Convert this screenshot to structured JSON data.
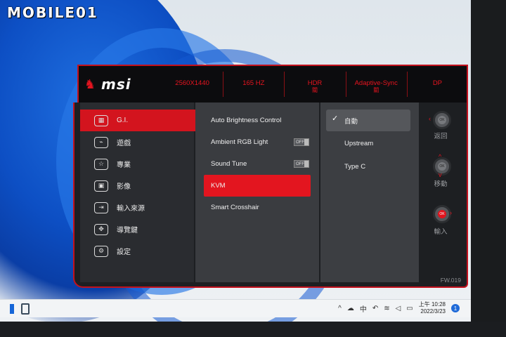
{
  "watermark": {
    "text": "MOBILE01"
  },
  "osd": {
    "brand": "msi",
    "status": [
      {
        "label": "2560X1440",
        "sub": ""
      },
      {
        "label": "165 HZ",
        "sub": ""
      },
      {
        "label": "HDR",
        "sub": "關"
      },
      {
        "label": "Adaptive-Sync",
        "sub": "關"
      },
      {
        "label": "DP",
        "sub": ""
      }
    ],
    "menu": [
      {
        "label": "G.I.",
        "icon": "gi-icon",
        "glyph": "▦",
        "active": true
      },
      {
        "label": "遊戲",
        "icon": "gamepad-icon",
        "glyph": "⌁",
        "active": false
      },
      {
        "label": "專業",
        "icon": "star-icon",
        "glyph": "☆",
        "active": false
      },
      {
        "label": "影像",
        "icon": "image-icon",
        "glyph": "▣",
        "active": false
      },
      {
        "label": "輸入來源",
        "icon": "input-source-icon",
        "glyph": "⇥",
        "active": false
      },
      {
        "label": "導覽鍵",
        "icon": "navi-key-icon",
        "glyph": "✥",
        "active": false
      },
      {
        "label": "設定",
        "icon": "settings-gear-icon",
        "glyph": "⚙",
        "active": false
      }
    ],
    "submenu": [
      {
        "label": "Auto Brightness Control",
        "toggle": ""
      },
      {
        "label": "Ambient RGB Light",
        "toggle": "OFF"
      },
      {
        "label": "Sound Tune",
        "toggle": "OFF"
      },
      {
        "label": "KVM",
        "toggle": ""
      },
      {
        "label": "Smart Crosshair",
        "toggle": ""
      }
    ],
    "options": [
      {
        "label": "自動",
        "selected": true
      },
      {
        "label": "Upstream",
        "selected": false
      },
      {
        "label": "Type C",
        "selected": false
      }
    ],
    "nav": [
      {
        "label": "返回",
        "center": "OK"
      },
      {
        "label": "移動",
        "center": "OK"
      },
      {
        "label": "輸入",
        "center": "OK"
      }
    ],
    "firmware": "FW.019"
  },
  "taskbar": {
    "tray_lang": "中",
    "time": "上午 10:28",
    "date": "2022/3/23",
    "notifications": "1"
  },
  "colors": {
    "accent": "#e3141f",
    "panel": "#1d1f22",
    "header": "#0c0c0e"
  }
}
